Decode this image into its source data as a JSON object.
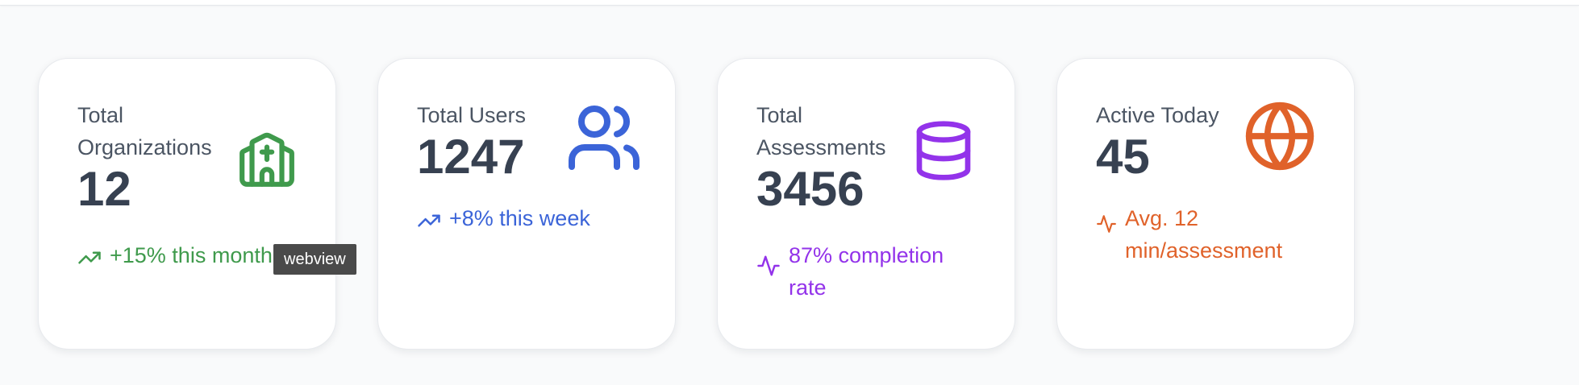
{
  "colors": {
    "green": "#3f9a4c",
    "blue": "#3b64d8",
    "purple": "#9333ea",
    "orange": "#e0622a",
    "value_text": "#374151",
    "label_text": "#4b5563"
  },
  "cards": [
    {
      "label_lines": [
        "Total",
        "Organizations"
      ],
      "value": "12",
      "icon": "church-icon",
      "trend_icon": "trending-up-icon",
      "trend_text": "+15% this month",
      "accent": "#3f9a4c"
    },
    {
      "label_lines": [
        "Total Users"
      ],
      "value": "1247",
      "icon": "users-icon",
      "trend_icon": "trending-up-icon",
      "trend_text": "+8% this week",
      "accent": "#3b64d8"
    },
    {
      "label_lines": [
        "Total",
        "Assessments"
      ],
      "value": "3456",
      "icon": "database-icon",
      "trend_icon": "activity-icon",
      "trend_lines": [
        "87% completion",
        "rate"
      ],
      "accent": "#9333ea"
    },
    {
      "label_lines": [
        "Active Today"
      ],
      "value": "45",
      "icon": "globe-icon",
      "trend_icon": "activity-icon",
      "trend_lines": [
        "Avg. 12",
        "min/assessment"
      ],
      "accent": "#e0622a"
    }
  ],
  "tooltip": {
    "text": "webview"
  }
}
